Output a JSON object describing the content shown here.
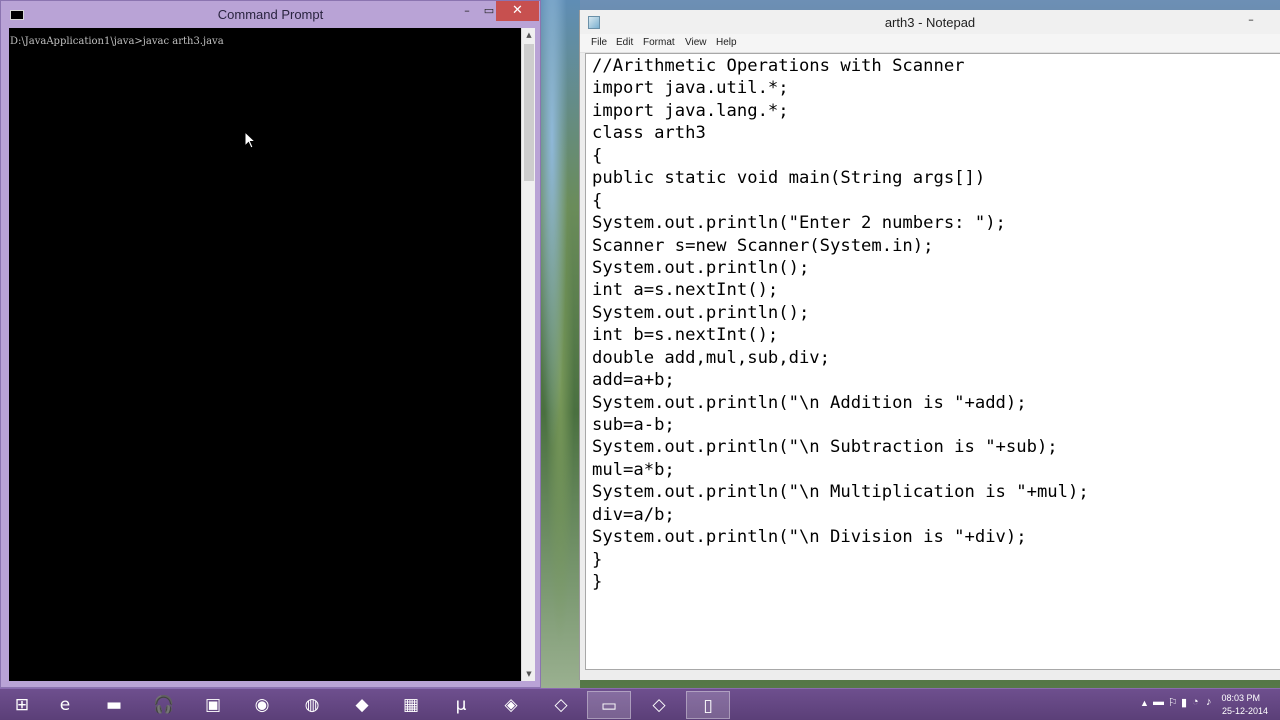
{
  "cmd": {
    "title": "Command Prompt",
    "icon_text": "C:\\",
    "line": "D:\\JavaApplication1\\java>javac arth3.java",
    "minimize": "–",
    "maximize": "▭",
    "close": "✕"
  },
  "notepad": {
    "title": "arth3 - Notepad",
    "minimize": "–",
    "menu": [
      "File",
      "Edit",
      "Format",
      "View",
      "Help"
    ],
    "code": [
      "//Arithmetic Operations with Scanner",
      "import java.util.*;",
      "import java.lang.*;",
      "class arth3",
      "{",
      "public static void main(String args[])",
      "{",
      "System.out.println(\"Enter 2 numbers: \");",
      "Scanner s=new Scanner(System.in);",
      "System.out.println();",
      "int a=s.nextInt();",
      "System.out.println();",
      "int b=s.nextInt();",
      "double add,mul,sub,div;",
      "add=a+b;",
      "System.out.println(\"\\n Addition is \"+add);",
      "sub=a-b;",
      "System.out.println(\"\\n Subtraction is \"+sub);",
      "mul=a*b;",
      "System.out.println(\"\\n Multiplication is \"+mul);",
      "div=a/b;",
      "System.out.println(\"\\n Division is \"+div);",
      "}",
      "}"
    ]
  },
  "taskbar": {
    "items": [
      {
        "name": "start-button",
        "glyph": "⊞"
      },
      {
        "name": "internet-explorer-icon",
        "glyph": "e"
      },
      {
        "name": "file-explorer-icon",
        "glyph": "▬"
      },
      {
        "name": "music-app-icon",
        "glyph": "🎧"
      },
      {
        "name": "store-icon",
        "glyph": "▣"
      },
      {
        "name": "chrome-icon",
        "glyph": "◉"
      },
      {
        "name": "firefox-icon",
        "glyph": "◍"
      },
      {
        "name": "red-app-icon",
        "glyph": "◆"
      },
      {
        "name": "grid-app-icon",
        "glyph": "▦"
      },
      {
        "name": "utorrent-icon",
        "glyph": "µ"
      },
      {
        "name": "layers-app-icon",
        "glyph": "◈"
      },
      {
        "name": "netbeans-icon",
        "glyph": "◇"
      },
      {
        "name": "command-prompt-taskbar-icon",
        "glyph": "▭"
      },
      {
        "name": "java-app-icon",
        "glyph": "◇"
      },
      {
        "name": "notepad-taskbar-icon",
        "glyph": "▯"
      }
    ],
    "tray": {
      "chevron": "▲",
      "icons": [
        "▬",
        "⚐",
        "▮",
        "◔",
        "♪"
      ],
      "time": "08:03 PM",
      "date": "25-12-2014"
    }
  }
}
